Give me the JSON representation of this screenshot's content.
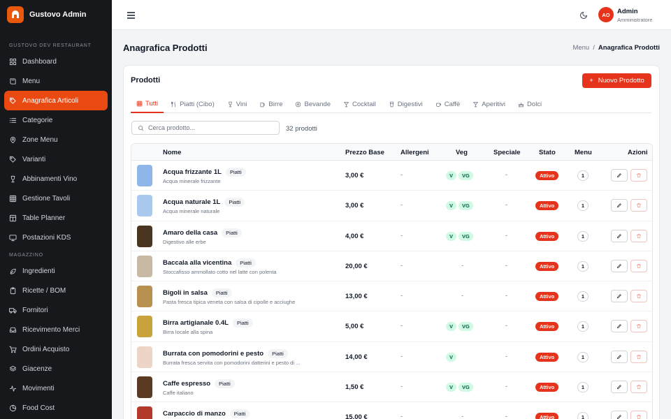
{
  "brand": {
    "name": "Gustovo Admin"
  },
  "sidebar": {
    "section1": "GUSTOVO DEV RESTAURANT",
    "items1": [
      {
        "label": "Dashboard",
        "icon": "dashboard-icon"
      },
      {
        "label": "Menu",
        "icon": "book-icon"
      },
      {
        "label": "Anagrafica Articoli",
        "icon": "tag-icon",
        "active": true
      },
      {
        "label": "Categorie",
        "icon": "list-icon"
      },
      {
        "label": "Zone Menu",
        "icon": "map-pin-icon"
      },
      {
        "label": "Varianti",
        "icon": "tag-icon"
      },
      {
        "label": "Abbinamenti Vino",
        "icon": "wine-icon"
      },
      {
        "label": "Gestione Tavoli",
        "icon": "grid-icon"
      },
      {
        "label": "Table Planner",
        "icon": "layout-icon"
      },
      {
        "label": "Postazioni KDS",
        "icon": "monitor-icon"
      }
    ],
    "section2": "MAGAZZINO",
    "items2": [
      {
        "label": "Ingredienti",
        "icon": "leaf-icon"
      },
      {
        "label": "Ricette / BOM",
        "icon": "clipboard-icon"
      },
      {
        "label": "Fornitori",
        "icon": "truck-icon"
      },
      {
        "label": "Ricevimento Merci",
        "icon": "inbox-icon"
      },
      {
        "label": "Ordini Acquisto",
        "icon": "cart-icon"
      },
      {
        "label": "Giacenze",
        "icon": "layers-icon"
      },
      {
        "label": "Movimenti",
        "icon": "activity-icon"
      },
      {
        "label": "Food Cost",
        "icon": "pie-icon"
      }
    ]
  },
  "header": {
    "user": {
      "initials": "AO",
      "name": "Admin",
      "role": "Amministratore"
    }
  },
  "page": {
    "title": "Anagrafica Prodotti",
    "breadcrumb": {
      "parent": "Menu",
      "separator": "/",
      "current": "Anagrafica Prodotti"
    }
  },
  "card": {
    "title": "Prodotti",
    "new_button": "Nuovo Prodotto",
    "tabs": [
      {
        "label": "Tutti",
        "icon": "grid-icon",
        "active": true
      },
      {
        "label": "Piatti (Cibo)",
        "icon": "utensils-icon"
      },
      {
        "label": "Vini",
        "icon": "wine-icon"
      },
      {
        "label": "Birre",
        "icon": "beer-icon"
      },
      {
        "label": "Bevande",
        "icon": "drink-icon"
      },
      {
        "label": "Cocktail",
        "icon": "cocktail-icon"
      },
      {
        "label": "Digestivi",
        "icon": "glass-icon"
      },
      {
        "label": "Caffè",
        "icon": "coffee-icon"
      },
      {
        "label": "Aperitivi",
        "icon": "cocktail-icon"
      },
      {
        "label": "Dolci",
        "icon": "cake-icon"
      }
    ],
    "search": {
      "placeholder": "Cerca prodotto..."
    },
    "count": "32 prodotti"
  },
  "table": {
    "columns": [
      "Nome",
      "Prezzo Base",
      "Allergeni",
      "Veg",
      "Speciale",
      "Stato",
      "Menu",
      "Azioni"
    ],
    "rows": [
      {
        "name": "Acqua frizzante 1L",
        "category": "Piatti",
        "desc": "Acqua minerale frizzante",
        "price": "3,00 €",
        "allergens": "-",
        "veg": [
          "V",
          "VG"
        ],
        "special": "-",
        "status": "Attivo",
        "menu": "1",
        "color": "#8fb6e8"
      },
      {
        "name": "Acqua naturale 1L",
        "category": "Piatti",
        "desc": "Acqua minerale naturale",
        "price": "3,00 €",
        "allergens": "-",
        "veg": [
          "V",
          "VG"
        ],
        "special": "-",
        "status": "Attivo",
        "menu": "1",
        "color": "#a9c9ee"
      },
      {
        "name": "Amaro della casa",
        "category": "Piatti",
        "desc": "Digestivo alle erbe",
        "price": "4,00 €",
        "allergens": "-",
        "veg": [
          "V",
          "VG"
        ],
        "special": "-",
        "status": "Attivo",
        "menu": "1",
        "color": "#4a3520"
      },
      {
        "name": "Baccala alla vicentina",
        "category": "Piatti",
        "desc": "Stoccafisso ammollato cotto nel latte con polenta",
        "price": "20,00 €",
        "allergens": "-",
        "veg": [],
        "veg_text": "-",
        "special": "-",
        "status": "Attivo",
        "menu": "1",
        "color": "#c7b9a4"
      },
      {
        "name": "Bigoli in salsa",
        "category": "Piatti",
        "desc": "Pasta fresca tipica veneta con salsa di cipolle e acciughe",
        "price": "13,00 €",
        "allergens": "-",
        "veg": [],
        "veg_text": "-",
        "special": "-",
        "status": "Attivo",
        "menu": "1",
        "color": "#b8904f"
      },
      {
        "name": "Birra artigianale 0.4L",
        "category": "Piatti",
        "desc": "Birra locale alla spina",
        "price": "5,00 €",
        "allergens": "-",
        "veg": [
          "V",
          "VG"
        ],
        "special": "-",
        "status": "Attivo",
        "menu": "1",
        "color": "#c9a43c"
      },
      {
        "name": "Burrata con pomodorini e pesto",
        "category": "Piatti",
        "desc": "Burrata fresca servita con pomodorini datterini e pesto di ...",
        "price": "14,00 €",
        "allergens": "-",
        "veg": [
          "V"
        ],
        "special": "-",
        "status": "Attivo",
        "menu": "1",
        "color": "#ecd5c6"
      },
      {
        "name": "Caffe espresso",
        "category": "Piatti",
        "desc": "Caffe italiano",
        "price": "1,50 €",
        "allergens": "-",
        "veg": [
          "V",
          "VG"
        ],
        "special": "-",
        "status": "Attivo",
        "menu": "1",
        "color": "#5a3a22"
      },
      {
        "name": "Carpaccio di manzo",
        "category": "Piatti",
        "desc": "",
        "price": "15,00 €",
        "allergens": "-",
        "veg": [],
        "veg_text": "-",
        "special": "-",
        "status": "Attivo",
        "menu": "1",
        "color": "#b33a2a"
      }
    ]
  },
  "colors": {
    "accent": "#e5341b",
    "sidebar_bg": "#17181c",
    "active_nav": "#ea4a12"
  }
}
